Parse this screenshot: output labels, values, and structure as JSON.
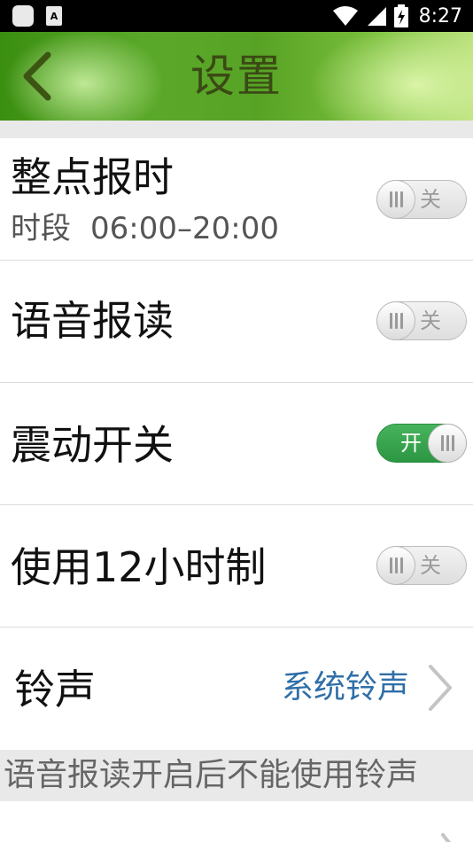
{
  "status_bar": {
    "time": "8:27",
    "notification_icon_letter": "A",
    "icons": [
      "app-notification-icon",
      "font-app-icon",
      "wifi-icon",
      "cell-signal-icon",
      "battery-charging-icon"
    ]
  },
  "header": {
    "title": "设置",
    "back_icon": "back-arrow-icon"
  },
  "settings": [
    {
      "id": "hourly-chime",
      "title": "整点报时",
      "subtitle_label": "时段",
      "subtitle_value": "06:00–20:00",
      "toggle_label": "关",
      "on": false
    },
    {
      "id": "voice-readout",
      "title": "语音报读",
      "toggle_label": "关",
      "on": false
    },
    {
      "id": "vibration",
      "title": "震动开关",
      "toggle_label": "开",
      "on": true
    },
    {
      "id": "12-hour",
      "title": "使用12小时制",
      "toggle_label": "关",
      "on": false
    }
  ],
  "ringtone": {
    "title": "铃声",
    "value": "系统铃声"
  },
  "note": {
    "text": "语音报读开启后不能使用铃声"
  },
  "colors": {
    "toggle_on": "#2e9a45",
    "link_blue": "#2f6fa8",
    "header_green": "#5aa82a"
  }
}
